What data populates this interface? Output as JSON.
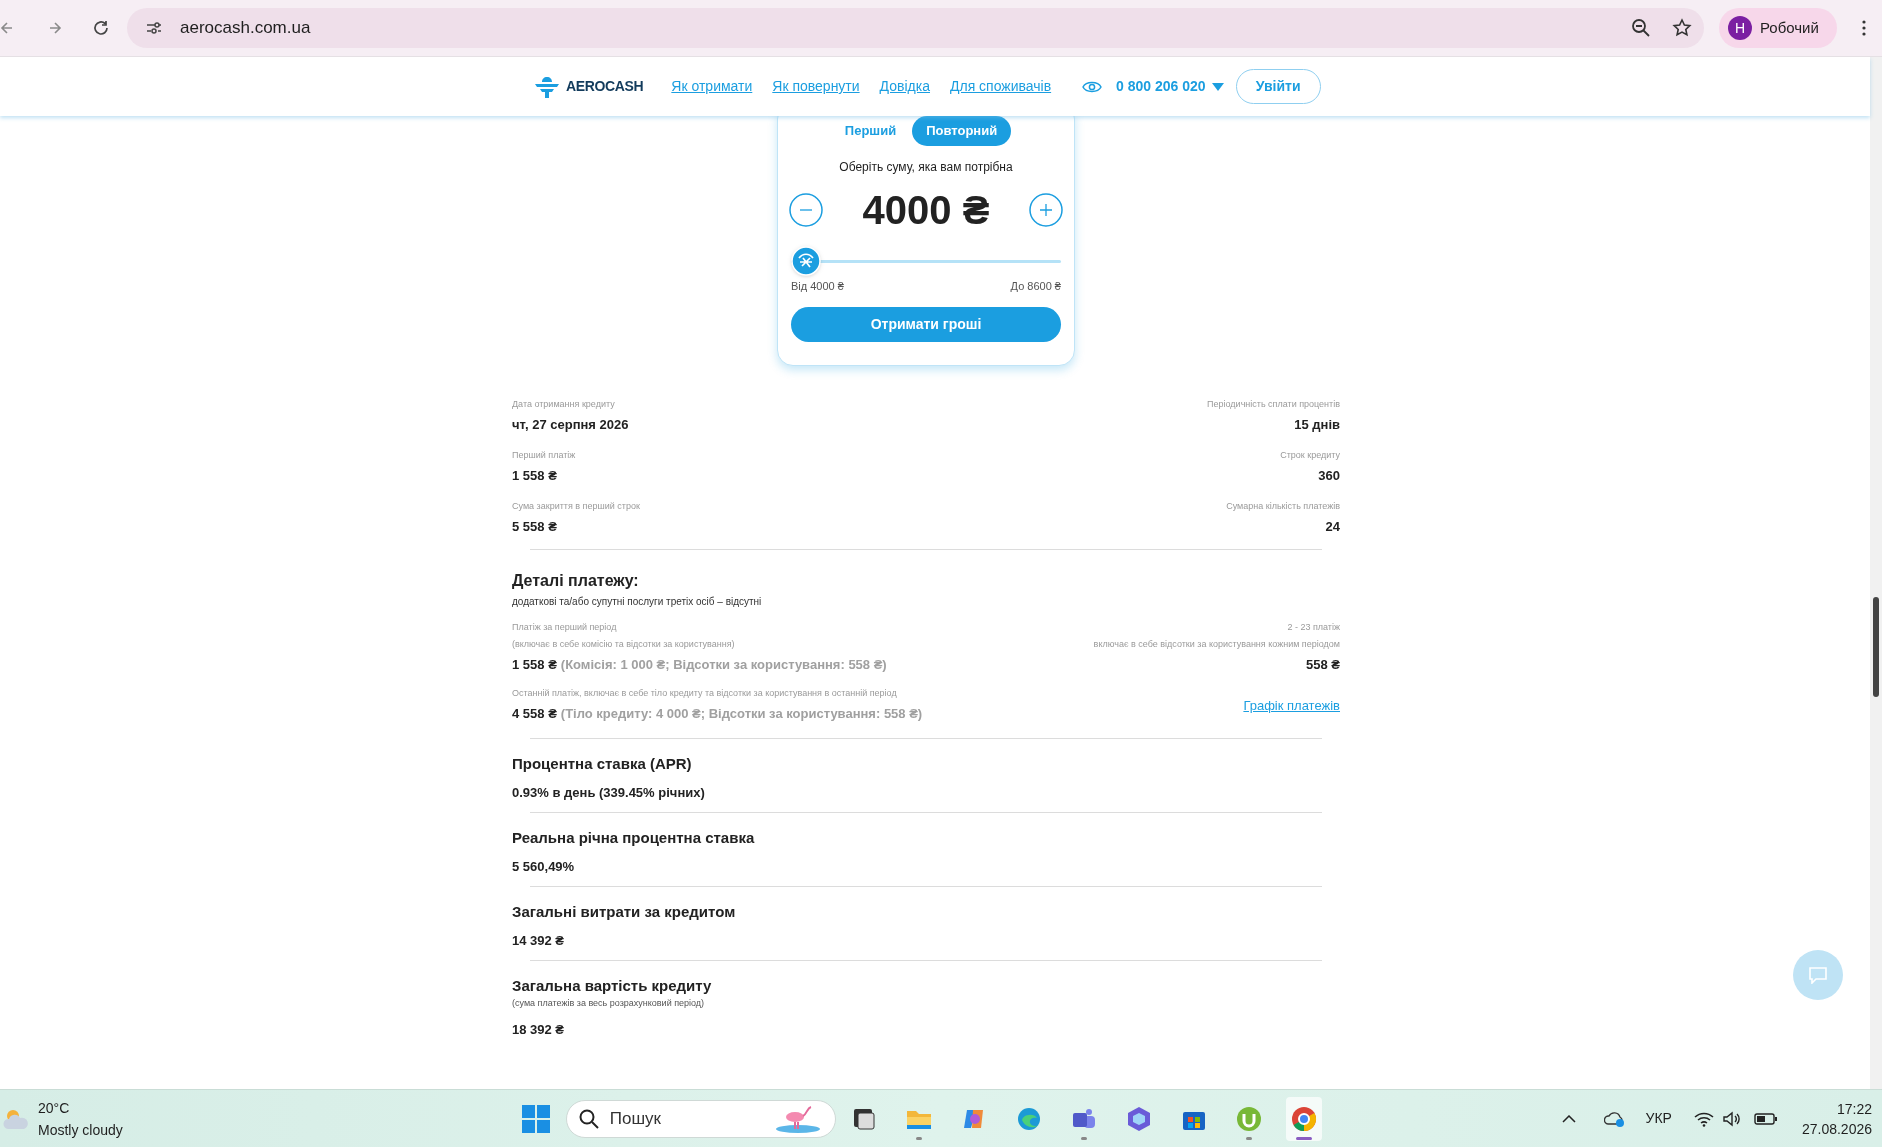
{
  "browser": {
    "url": "aerocash.com.ua",
    "profile_initial": "Н",
    "profile_name": "Робочий"
  },
  "header": {
    "brand": "AEROCASH",
    "nav": [
      "Як отримати",
      "Як повернути",
      "Довідка",
      "Для споживачів"
    ],
    "phone": "0 800 206 020",
    "login": "Увійти"
  },
  "calculator": {
    "tabs": [
      {
        "label": "Перший",
        "selected": false
      },
      {
        "label": "Повторний",
        "selected": true
      }
    ],
    "prompt": "Оберіть суму, яка вам потрібна",
    "amount": "4000 ₴",
    "slider": {
      "level": 0
    },
    "min_label": "Від 4000 ₴",
    "max_label": "До 8600 ₴",
    "button": "Отримати гроші"
  },
  "summary": [
    {
      "left": {
        "label": "Дата отримання кредиту",
        "value": "чт, 27 серпня 2026"
      },
      "right": {
        "label": "Періодичність сплати процентів",
        "value": "15 днів"
      }
    },
    {
      "left": {
        "label": "Перший платіж",
        "value": "1 558 ₴"
      },
      "right": {
        "label": "Строк кредиту",
        "value": "360"
      }
    },
    {
      "left": {
        "label": "Сума закриття в перший строк",
        "value": "5 558 ₴"
      },
      "right": {
        "label": "Сумарна кількість платежів",
        "value": "24"
      }
    }
  ],
  "payment_details": {
    "title": "Деталі платежу:",
    "subtitle": "додаткові та/або супутні послуги третіх осіб – відсутні",
    "first": {
      "label": "Платіж за перший період",
      "note": "(включає в себе комісію та відсотки за користування)",
      "amount": "1 558 ₴",
      "breakdown": "(Комісія: 1 000 ₴; Відсотки за користування: 558 ₴)"
    },
    "regular": {
      "label": "2 - 23 платіж",
      "note": "включає в себе відсотки за користування кожним періодом",
      "amount": "558 ₴"
    },
    "last": {
      "label": "Останній платіж, включає в себе тіло кредиту та відсотки за користування в останній період",
      "amount": "4 558 ₴",
      "breakdown": "(Тіло кредиту: 4 000 ₴; Відсотки за користування: 558 ₴)"
    },
    "schedule_link": "Графік платежів"
  },
  "sections": [
    {
      "title": "Процентна ставка (APR)",
      "value": "0.93% в день (339.45% річних)"
    },
    {
      "title": "Реальна річна процентна ставка",
      "value": "5 560,49%"
    },
    {
      "title": "Загальні витрати за кредитом",
      "value": "14 392 ₴"
    },
    {
      "title": "Загальна вартість кредиту",
      "note": "(сума платежів за весь розрахунковий період)",
      "value": "18 392 ₴"
    }
  ],
  "taskbar": {
    "temperature": "20°C",
    "weather": "Mostly cloudy",
    "search_placeholder": "Пошук",
    "language": "УКР",
    "time": "17:22",
    "date": "27.08.2026"
  }
}
